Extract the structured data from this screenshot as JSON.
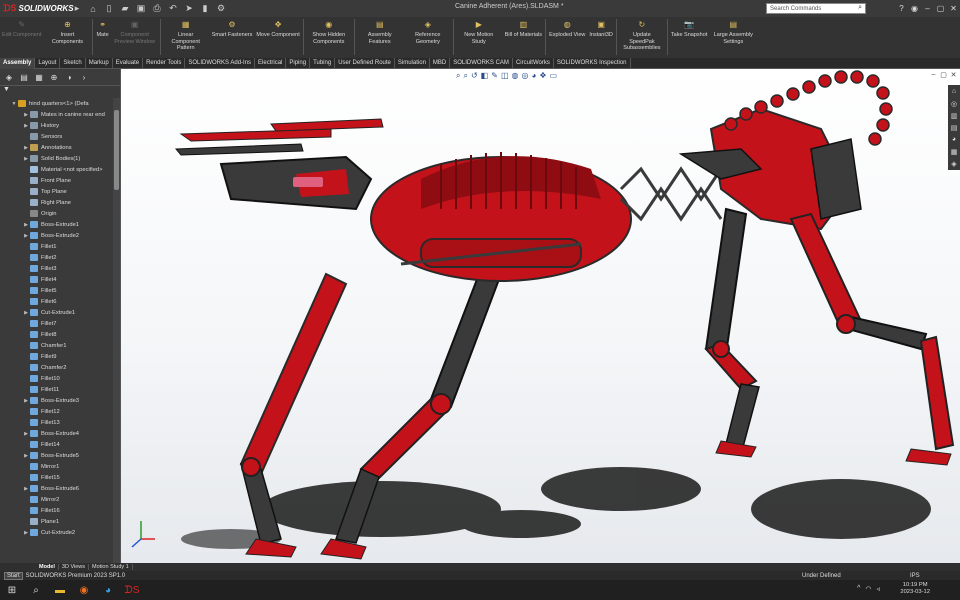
{
  "app": {
    "brand": "SOLIDWORKS",
    "title": "Canine Adherent (Ares).SLDASM *",
    "search_placeholder": "Search Commands"
  },
  "ribbon": [
    {
      "label": "Edit Component",
      "enabled": false
    },
    {
      "label": "Insert Components",
      "enabled": true
    },
    {
      "label": "Mate",
      "enabled": true
    },
    {
      "label": "Component Preview Window",
      "enabled": false
    },
    {
      "label": "Linear Component Pattern",
      "enabled": true
    },
    {
      "label": "Smart Fasteners",
      "enabled": true
    },
    {
      "label": "Move Component",
      "enabled": true
    },
    {
      "label": "Show Hidden Components",
      "enabled": true
    },
    {
      "label": "Assembly Features",
      "enabled": true
    },
    {
      "label": "Reference Geometry",
      "enabled": true
    },
    {
      "label": "New Motion Study",
      "enabled": true
    },
    {
      "label": "Bill of Materials",
      "enabled": true
    },
    {
      "label": "Exploded View",
      "enabled": true
    },
    {
      "label": "Instant3D",
      "enabled": true
    },
    {
      "label": "Update SpeedPak Subassemblies",
      "enabled": true
    },
    {
      "label": "Take Snapshot",
      "enabled": true
    },
    {
      "label": "Large Assembly Settings",
      "enabled": true
    }
  ],
  "tabs": [
    "Assembly",
    "Layout",
    "Sketch",
    "Markup",
    "Evaluate",
    "Render Tools",
    "SOLIDWORKS Add-Ins",
    "Electrical",
    "Piping",
    "Tubing",
    "User Defined Route",
    "Simulation",
    "MBD",
    "SOLIDWORKS CAM",
    "CircuitWorks",
    "SOLIDWORKS Inspection"
  ],
  "active_tab": "Assembly",
  "tree": [
    {
      "label": "hind quarters<1> (Defa",
      "level": 0,
      "expand": "open",
      "icon": "#d8a020"
    },
    {
      "label": "Mates in canine rear end",
      "level": 1,
      "expand": "closed",
      "icon": "#8899aa"
    },
    {
      "label": "History",
      "level": 1,
      "expand": "closed",
      "icon": "#8899aa"
    },
    {
      "label": "Sensors",
      "level": 1,
      "expand": "none",
      "icon": "#8899aa"
    },
    {
      "label": "Annotations",
      "level": 1,
      "expand": "closed",
      "icon": "#c0a050"
    },
    {
      "label": "Solid Bodies(1)",
      "level": 1,
      "expand": "closed",
      "icon": "#8899aa"
    },
    {
      "label": "Material <not specified>",
      "level": 1,
      "expand": "none",
      "icon": "#a0c0e0"
    },
    {
      "label": "Front Plane",
      "level": 1,
      "expand": "none",
      "icon": "#9ab0c8"
    },
    {
      "label": "Top Plane",
      "level": 1,
      "expand": "none",
      "icon": "#9ab0c8"
    },
    {
      "label": "Right Plane",
      "level": 1,
      "expand": "none",
      "icon": "#9ab0c8"
    },
    {
      "label": "Origin",
      "level": 1,
      "expand": "none",
      "icon": "#888888"
    },
    {
      "label": "Boss-Extrude1",
      "level": 1,
      "expand": "closed",
      "icon": "#6fa8dc"
    },
    {
      "label": "Boss-Extrude2",
      "level": 1,
      "expand": "closed",
      "icon": "#6fa8dc"
    },
    {
      "label": "Fillet1",
      "level": 1,
      "expand": "none",
      "icon": "#6fa8dc"
    },
    {
      "label": "Fillet2",
      "level": 1,
      "expand": "none",
      "icon": "#6fa8dc"
    },
    {
      "label": "Fillet3",
      "level": 1,
      "expand": "none",
      "icon": "#6fa8dc"
    },
    {
      "label": "Fillet4",
      "level": 1,
      "expand": "none",
      "icon": "#6fa8dc"
    },
    {
      "label": "Fillet5",
      "level": 1,
      "expand": "none",
      "icon": "#6fa8dc"
    },
    {
      "label": "Fillet6",
      "level": 1,
      "expand": "none",
      "icon": "#6fa8dc"
    },
    {
      "label": "Cut-Extrude1",
      "level": 1,
      "expand": "closed",
      "icon": "#6fa8dc"
    },
    {
      "label": "Fillet7",
      "level": 1,
      "expand": "none",
      "icon": "#6fa8dc"
    },
    {
      "label": "Fillet8",
      "level": 1,
      "expand": "none",
      "icon": "#6fa8dc"
    },
    {
      "label": "Chamfer1",
      "level": 1,
      "expand": "none",
      "icon": "#6fa8dc"
    },
    {
      "label": "Fillet9",
      "level": 1,
      "expand": "none",
      "icon": "#6fa8dc"
    },
    {
      "label": "Chamfer2",
      "level": 1,
      "expand": "none",
      "icon": "#6fa8dc"
    },
    {
      "label": "Fillet10",
      "level": 1,
      "expand": "none",
      "icon": "#6fa8dc"
    },
    {
      "label": "Fillet11",
      "level": 1,
      "expand": "none",
      "icon": "#6fa8dc"
    },
    {
      "label": "Boss-Extrude3",
      "level": 1,
      "expand": "closed",
      "icon": "#6fa8dc"
    },
    {
      "label": "Fillet12",
      "level": 1,
      "expand": "none",
      "icon": "#6fa8dc"
    },
    {
      "label": "Fillet13",
      "level": 1,
      "expand": "none",
      "icon": "#6fa8dc"
    },
    {
      "label": "Boss-Extrude4",
      "level": 1,
      "expand": "closed",
      "icon": "#6fa8dc"
    },
    {
      "label": "Fillet14",
      "level": 1,
      "expand": "none",
      "icon": "#6fa8dc"
    },
    {
      "label": "Boss-Extrude5",
      "level": 1,
      "expand": "closed",
      "icon": "#6fa8dc"
    },
    {
      "label": "Mirror1",
      "level": 1,
      "expand": "none",
      "icon": "#6fa8dc"
    },
    {
      "label": "Fillet15",
      "level": 1,
      "expand": "none",
      "icon": "#6fa8dc"
    },
    {
      "label": "Boss-Extrude6",
      "level": 1,
      "expand": "closed",
      "icon": "#6fa8dc"
    },
    {
      "label": "Mirror2",
      "level": 1,
      "expand": "none",
      "icon": "#6fa8dc"
    },
    {
      "label": "Fillet16",
      "level": 1,
      "expand": "none",
      "icon": "#6fa8dc"
    },
    {
      "label": "Plane1",
      "level": 1,
      "expand": "none",
      "icon": "#9ab0c8"
    },
    {
      "label": "Cut-Extrude2",
      "level": 1,
      "expand": "closed",
      "icon": "#6fa8dc"
    }
  ],
  "bottom_tabs": [
    "Model",
    "3D Views",
    "Motion Study 1"
  ],
  "status": {
    "left": "SOLIDWORKS Premium 2023 SP1.0",
    "mid": "Under Defined",
    "units": "IPS"
  },
  "taskbar": {
    "start_tooltip": "Start",
    "time": "10:19 PM",
    "date": "2023-03-12"
  },
  "colors": {
    "model_red": "#c4121a",
    "model_dark": "#3a3a3a",
    "accent": "#d22222"
  }
}
